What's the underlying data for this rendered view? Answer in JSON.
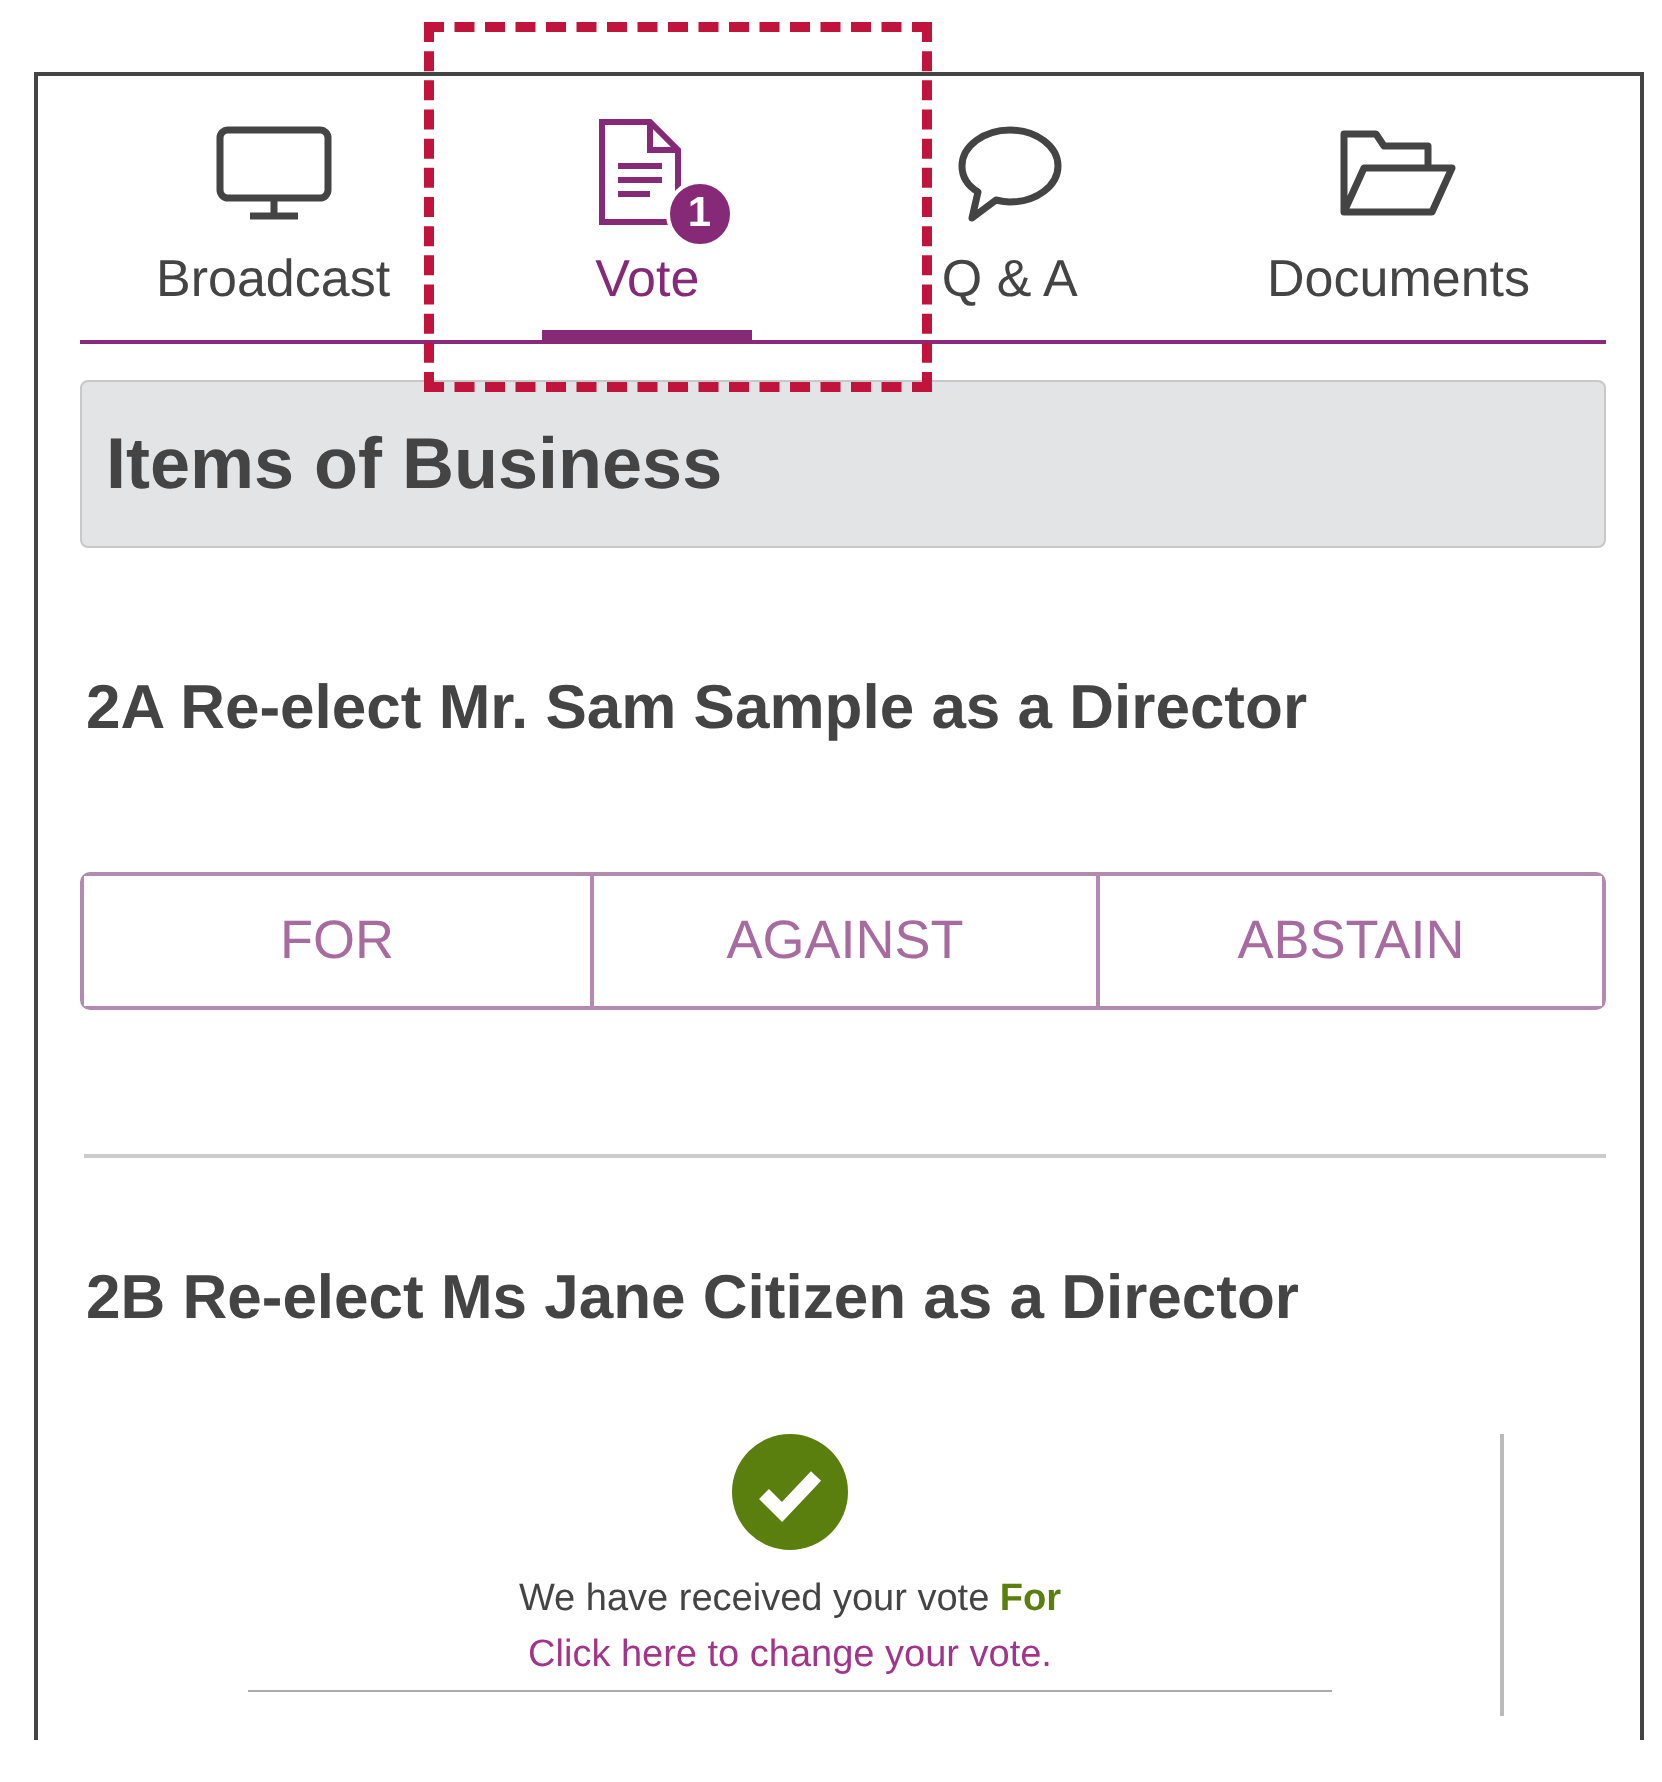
{
  "tabs": [
    {
      "label": "Broadcast",
      "kind": "monitor",
      "highlighted": false,
      "selected": false
    },
    {
      "label": "Vote",
      "kind": "document",
      "highlighted": true,
      "badge": "1",
      "selected": true
    },
    {
      "label": "Q & A",
      "kind": "speech",
      "highlighted": false,
      "selected": false
    },
    {
      "label": "Documents",
      "kind": "folder",
      "highlighted": false,
      "selected": false
    }
  ],
  "section_title": "Items of Business",
  "items": [
    {
      "title": "2A Re-elect Mr. Sam Sample as a Director",
      "kind": "options",
      "options": [
        {
          "label": "FOR",
          "selected": false
        },
        {
          "label": "AGAINST",
          "selected": false
        },
        {
          "label": "ABSTAIN",
          "selected": false
        }
      ]
    },
    {
      "title": "2B Re-elect Ms Jane Citizen as a Director",
      "kind": "received",
      "message": "We have received your vote **For**",
      "link": "Click here to change your vote."
    }
  ]
}
